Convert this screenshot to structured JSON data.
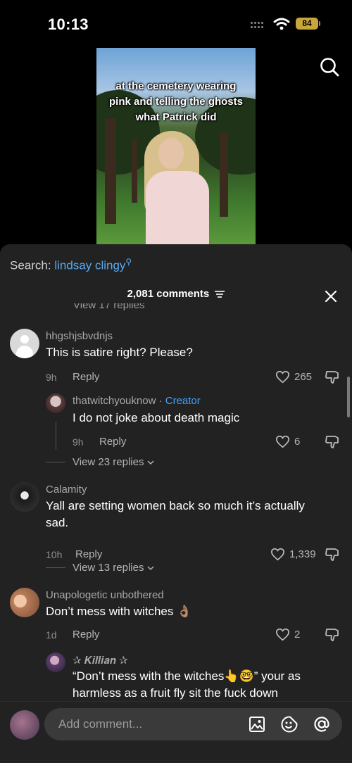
{
  "status_bar": {
    "time": "10:13",
    "battery": "84"
  },
  "video": {
    "caption_lines": [
      "at the cemetery wearing",
      "pink and telling the ghosts",
      "what Patrick did"
    ]
  },
  "sheet": {
    "search_label": "Search: ",
    "search_term": "lindsay clingy",
    "comment_count": "2,081 comments",
    "clipped_hint": "View 17 replies"
  },
  "comments": [
    {
      "username": "hhgshjsbvdnjs",
      "text": "This is satire right? Please?",
      "time": "9h",
      "reply_label": "Reply",
      "likes": "265"
    },
    {
      "username": "thatwitchyouknow",
      "separator": " · ",
      "badge": "Creator",
      "text": "I do not joke about death magic",
      "time": "9h",
      "reply_label": "Reply",
      "likes": "6",
      "view_replies": "View 23 replies"
    },
    {
      "username": "Calamity",
      "text_line1": "Yall are setting women back so much it’s actually",
      "text_line2": "sad.",
      "time": "10h",
      "reply_label": "Reply",
      "likes": "1,339",
      "view_replies": "View 13 replies"
    },
    {
      "username": "Unapologetic unbothered",
      "text": "Don’t mess with witches 👌🏽",
      "time": "1d",
      "reply_label": "Reply",
      "likes": "2"
    },
    {
      "username": "✰ 𝑲𝒊𝒍𝒍𝒊𝒂𝒏 ✰",
      "text_line1": "“Don’t mess with the witches👆🤓” your as",
      "text_line2": "harmless as a fruit fly sit the fuck down"
    }
  ],
  "composer": {
    "placeholder": "Add comment..."
  },
  "colors": {
    "sheet_bg": "#222222",
    "accent_blue": "#3ea3ff",
    "search_blue": "#5aa9ef"
  },
  "icons": [
    "search-icon",
    "filter-icon",
    "close-icon",
    "heart-icon",
    "dislike-icon",
    "chevron-down-icon",
    "image-icon",
    "emoji-icon",
    "at-icon"
  ]
}
